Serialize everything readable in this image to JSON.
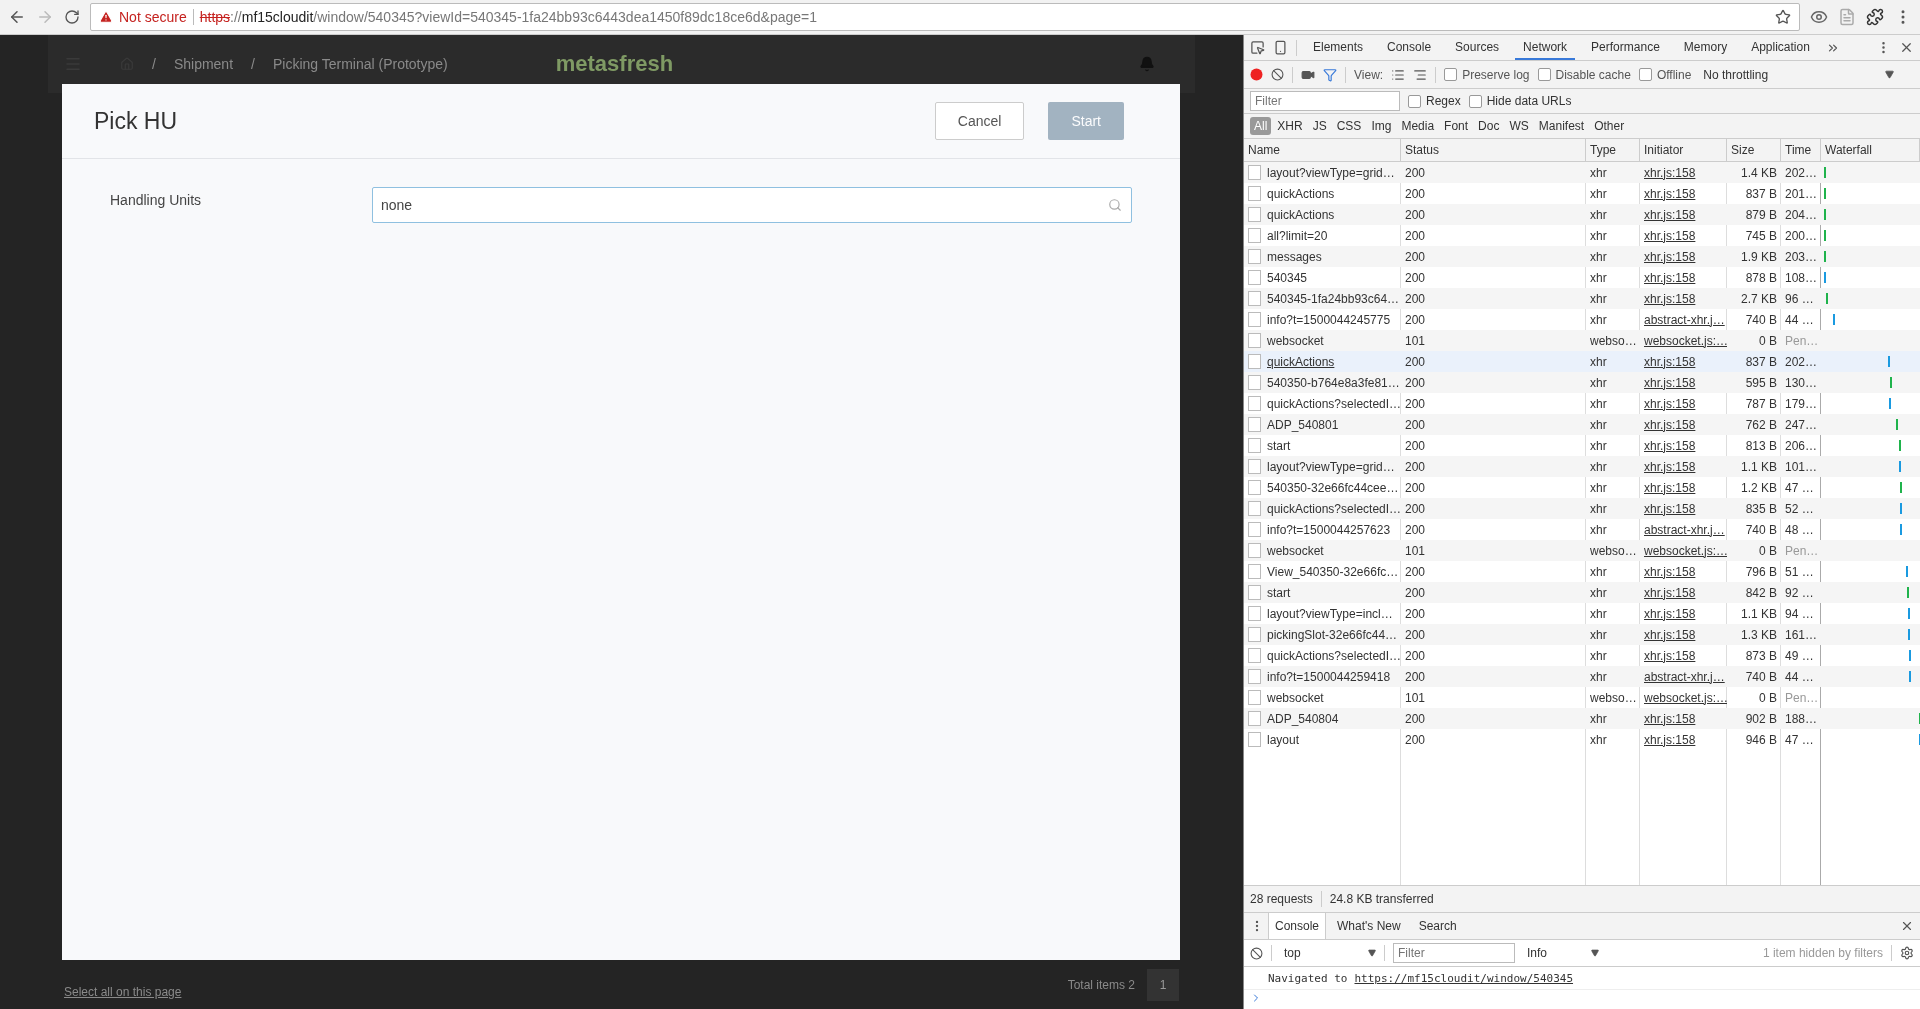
{
  "browser": {
    "security": "Not secure",
    "url": {
      "scheme": "https",
      "separator": "://",
      "host": "mf15cloudit",
      "path": "/window/540345?viewId=540345-1fa24bb93c6443dea1450f89dc18ce6d&page=1"
    }
  },
  "background_app": {
    "breadcrumb_separator": "/",
    "breadcrumbs": [
      "Shipment",
      "Picking Terminal (Prototype)"
    ],
    "logo": "metasfresh",
    "select_all_link": "Select all on this page",
    "total_items": "Total items 2",
    "page": "1"
  },
  "modal": {
    "title": "Pick HU",
    "buttons": [
      {
        "label": "Cancel",
        "kind": "secondary",
        "disabled": false
      },
      {
        "label": "Start",
        "kind": "primary",
        "disabled": true
      }
    ],
    "fields": [
      {
        "label": "Handling Units",
        "value": "none"
      }
    ]
  },
  "devtools": {
    "tabs": [
      {
        "label": "Elements",
        "selected": false
      },
      {
        "label": "Console",
        "selected": false
      },
      {
        "label": "Sources",
        "selected": false
      },
      {
        "label": "Network",
        "selected": true
      },
      {
        "label": "Performance",
        "selected": false
      },
      {
        "label": "Memory",
        "selected": false
      },
      {
        "label": "Application",
        "selected": false
      }
    ],
    "view_label": "View:",
    "options": [
      {
        "label": "Preserve log",
        "checked": false
      },
      {
        "label": "Disable cache",
        "checked": false
      },
      {
        "label": "Offline",
        "checked": false
      }
    ],
    "throttling": "No throttling",
    "filter": {
      "placeholder": "Filter"
    },
    "filter_options": [
      {
        "label": "Regex",
        "checked": false
      },
      {
        "label": "Hide data URLs",
        "checked": false
      }
    ],
    "type_filters": [
      {
        "label": "All",
        "selected": true
      },
      {
        "label": "XHR",
        "selected": false
      },
      {
        "label": "JS",
        "selected": false
      },
      {
        "label": "CSS",
        "selected": false
      },
      {
        "label": "Img",
        "selected": false
      },
      {
        "label": "Media",
        "selected": false
      },
      {
        "label": "Font",
        "selected": false
      },
      {
        "label": "Doc",
        "selected": false
      },
      {
        "label": "WS",
        "selected": false
      },
      {
        "label": "Manifest",
        "selected": false
      },
      {
        "label": "Other",
        "selected": false
      }
    ],
    "columns": [
      "Name",
      "Status",
      "Type",
      "Initiator",
      "Size",
      "Time",
      "Waterfall"
    ],
    "rows": [
      {
        "name": "layout?viewType=grid…",
        "status": "200",
        "type": "xhr",
        "initiator": "xhr.js:158",
        "size": "1.4 KB",
        "time": "202…",
        "pending": false,
        "selected": false
      },
      {
        "name": "quickActions",
        "status": "200",
        "type": "xhr",
        "initiator": "xhr.js:158",
        "size": "837 B",
        "time": "201…",
        "pending": false,
        "selected": false
      },
      {
        "name": "quickActions",
        "status": "200",
        "type": "xhr",
        "initiator": "xhr.js:158",
        "size": "879 B",
        "time": "204…",
        "pending": false,
        "selected": false
      },
      {
        "name": "all?limit=20",
        "status": "200",
        "type": "xhr",
        "initiator": "xhr.js:158",
        "size": "745 B",
        "time": "200…",
        "pending": false,
        "selected": false
      },
      {
        "name": "messages",
        "status": "200",
        "type": "xhr",
        "initiator": "xhr.js:158",
        "size": "1.9 KB",
        "time": "203…",
        "pending": false,
        "selected": false
      },
      {
        "name": "540345",
        "status": "200",
        "type": "xhr",
        "initiator": "xhr.js:158",
        "size": "878 B",
        "time": "108…",
        "pending": false,
        "selected": false
      },
      {
        "name": "540345-1fa24bb93c64…",
        "status": "200",
        "type": "xhr",
        "initiator": "xhr.js:158",
        "size": "2.7 KB",
        "time": "96 …",
        "pending": false,
        "selected": false
      },
      {
        "name": "info?t=1500044245775",
        "status": "200",
        "type": "xhr",
        "initiator": "abstract-xhr.j…",
        "size": "740 B",
        "time": "44 …",
        "pending": false,
        "selected": false
      },
      {
        "name": "websocket",
        "status": "101",
        "type": "webso…",
        "initiator": "websocket.js:…",
        "size": "0 B",
        "time": "Pen…",
        "pending": true,
        "selected": false
      },
      {
        "name": "quickActions",
        "status": "200",
        "type": "xhr",
        "initiator": "xhr.js:158",
        "size": "837 B",
        "time": "202…",
        "pending": false,
        "selected": true
      },
      {
        "name": "540350-b764e8a3fe81…",
        "status": "200",
        "type": "xhr",
        "initiator": "xhr.js:158",
        "size": "595 B",
        "time": "130…",
        "pending": false,
        "selected": false
      },
      {
        "name": "quickActions?selectedI…",
        "status": "200",
        "type": "xhr",
        "initiator": "xhr.js:158",
        "size": "787 B",
        "time": "179…",
        "pending": false,
        "selected": false
      },
      {
        "name": "ADP_540801",
        "status": "200",
        "type": "xhr",
        "initiator": "xhr.js:158",
        "size": "762 B",
        "time": "247…",
        "pending": false,
        "selected": false
      },
      {
        "name": "start",
        "status": "200",
        "type": "xhr",
        "initiator": "xhr.js:158",
        "size": "813 B",
        "time": "206…",
        "pending": false,
        "selected": false
      },
      {
        "name": "layout?viewType=grid…",
        "status": "200",
        "type": "xhr",
        "initiator": "xhr.js:158",
        "size": "1.1 KB",
        "time": "101…",
        "pending": false,
        "selected": false
      },
      {
        "name": "540350-32e66fc44cee…",
        "status": "200",
        "type": "xhr",
        "initiator": "xhr.js:158",
        "size": "1.2 KB",
        "time": "47 …",
        "pending": false,
        "selected": false
      },
      {
        "name": "quickActions?selectedI…",
        "status": "200",
        "type": "xhr",
        "initiator": "xhr.js:158",
        "size": "835 B",
        "time": "52 …",
        "pending": false,
        "selected": false
      },
      {
        "name": "info?t=1500044257623",
        "status": "200",
        "type": "xhr",
        "initiator": "abstract-xhr.j…",
        "size": "740 B",
        "time": "48 …",
        "pending": false,
        "selected": false
      },
      {
        "name": "websocket",
        "status": "101",
        "type": "webso…",
        "initiator": "websocket.js:…",
        "size": "0 B",
        "time": "Pen…",
        "pending": true,
        "selected": false
      },
      {
        "name": "View_540350-32e66fc…",
        "status": "200",
        "type": "xhr",
        "initiator": "xhr.js:158",
        "size": "796 B",
        "time": "51 …",
        "pending": false,
        "selected": false
      },
      {
        "name": "start",
        "status": "200",
        "type": "xhr",
        "initiator": "xhr.js:158",
        "size": "842 B",
        "time": "92 …",
        "pending": false,
        "selected": false
      },
      {
        "name": "layout?viewType=incl…",
        "status": "200",
        "type": "xhr",
        "initiator": "xhr.js:158",
        "size": "1.1 KB",
        "time": "94 …",
        "pending": false,
        "selected": false
      },
      {
        "name": "pickingSlot-32e66fc44…",
        "status": "200",
        "type": "xhr",
        "initiator": "xhr.js:158",
        "size": "1.3 KB",
        "time": "161…",
        "pending": false,
        "selected": false
      },
      {
        "name": "quickActions?selectedI…",
        "status": "200",
        "type": "xhr",
        "initiator": "xhr.js:158",
        "size": "873 B",
        "time": "49 …",
        "pending": false,
        "selected": false
      },
      {
        "name": "info?t=1500044259418",
        "status": "200",
        "type": "xhr",
        "initiator": "abstract-xhr.j…",
        "size": "740 B",
        "time": "44 …",
        "pending": false,
        "selected": false
      },
      {
        "name": "websocket",
        "status": "101",
        "type": "webso…",
        "initiator": "websocket.js:…",
        "size": "0 B",
        "time": "Pen…",
        "pending": true,
        "selected": false
      },
      {
        "name": "ADP_540804",
        "status": "200",
        "type": "xhr",
        "initiator": "xhr.js:158",
        "size": "902 B",
        "time": "188…",
        "pending": false,
        "selected": false
      },
      {
        "name": "layout",
        "status": "200",
        "type": "xhr",
        "initiator": "xhr.js:158",
        "size": "946 B",
        "time": "47 …",
        "pending": false,
        "selected": false
      }
    ],
    "summary": {
      "requests": "28 requests",
      "transferred": "24.8 KB transferred"
    },
    "drawer_tabs": [
      {
        "label": "Console",
        "selected": true
      },
      {
        "label": "What's New",
        "selected": false
      },
      {
        "label": "Search",
        "selected": false
      }
    ],
    "console": {
      "context": "top",
      "filter": {
        "placeholder": "Filter"
      },
      "level": "Info",
      "hidden_note": "1 item hidden by filters",
      "messages": [
        {
          "text": "Navigated to",
          "link": "https://mf15cloudit/window/540345"
        }
      ]
    }
  }
}
